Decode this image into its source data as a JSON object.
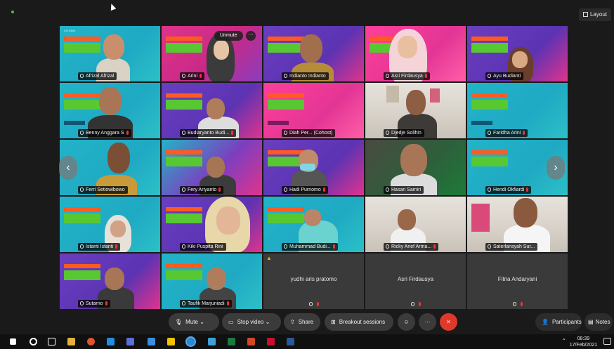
{
  "layout_button": "Layout",
  "overlay": {
    "unmute": "Unmute",
    "more": "···"
  },
  "tiles": [
    {
      "name": "Afrizal Afrizal"
    },
    {
      "name": "Arini"
    },
    {
      "name": "Indianto Indianto"
    },
    {
      "name": "Asri Firdausya"
    },
    {
      "name": "Ayu Budianti"
    },
    {
      "name": "Benny Anggara S"
    },
    {
      "name": "Budiaryanto Budi..."
    },
    {
      "name": "Diah Per... (Cohost)"
    },
    {
      "name": "Djedje Solihin"
    },
    {
      "name": "Faridha Arini"
    },
    {
      "name": "Ferri Setiowibowo"
    },
    {
      "name": "Fery Ariyanto"
    },
    {
      "name": "Hadi Purnomo"
    },
    {
      "name": "Hasan Samiri"
    },
    {
      "name": "Hendi Okfiardi"
    },
    {
      "name": "Istanti Istanti"
    },
    {
      "name": "Kiki Puspita Rini"
    },
    {
      "name": "Muhammad Budi..."
    },
    {
      "name": "Ricky Arief Arma..."
    },
    {
      "name": "Saterlansyah Sur..."
    },
    {
      "name": "Sutarno"
    },
    {
      "name": "Taufik Marjuniadi"
    },
    {
      "name": "yudhi aris pratomo"
    },
    {
      "name": "Asri Firdausya"
    },
    {
      "name": "Fitria Andaryani"
    }
  ],
  "toolbar": {
    "mute": "Mute",
    "stop_video": "Stop video",
    "share": "Share",
    "breakout": "Breakout sessions",
    "participants": "Participants",
    "notes": "Notes"
  },
  "taskbar": {
    "time": "08:39",
    "date": "17/Feb/2021"
  },
  "colors": {
    "end_call": "#e0392b",
    "toolbar_bg": "#3b3b3b",
    "app_bg": "#1a1a1a"
  }
}
